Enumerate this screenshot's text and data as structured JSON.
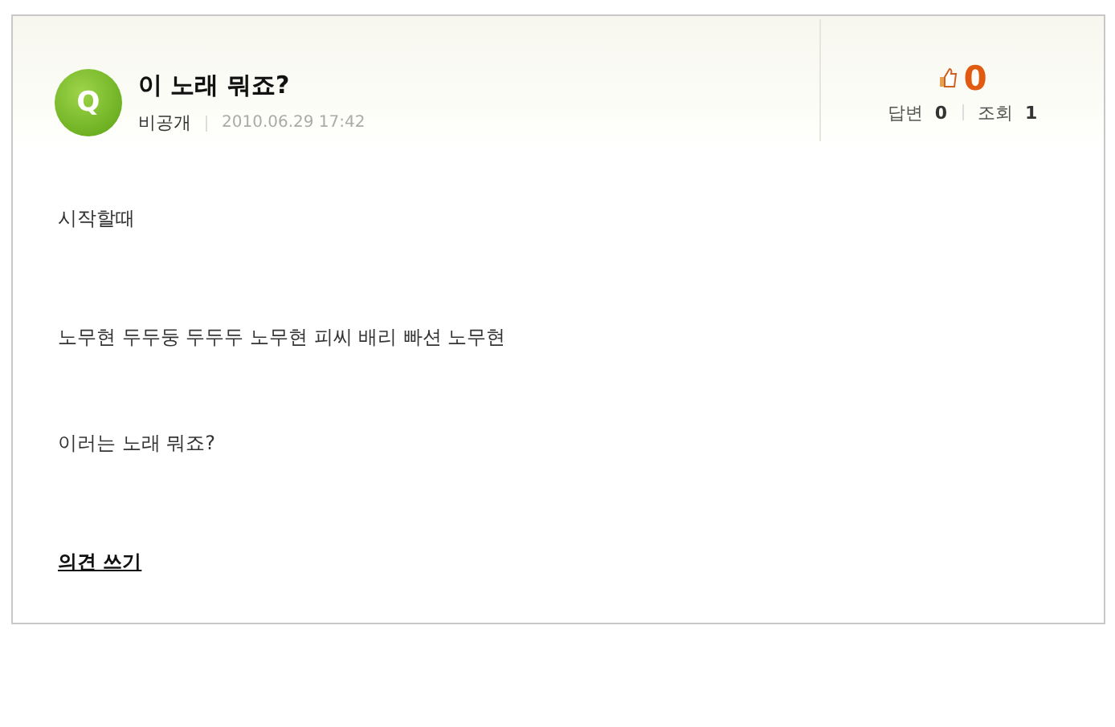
{
  "question": {
    "badge": "Q",
    "title": "이 노래 뭐죠?",
    "author": "비공개",
    "date": "2010.06.29 17:42"
  },
  "stats": {
    "likes": "0",
    "answers_label": "답변",
    "answers": "0",
    "views_label": "조회",
    "views": "1"
  },
  "body": [
    "시작할때",
    "노무현 두두둥 두두두 노무현 피씨 배리 빠션 노무현",
    "이러는 노래 뭐죠?"
  ],
  "comment_link": "의견 쓰기"
}
